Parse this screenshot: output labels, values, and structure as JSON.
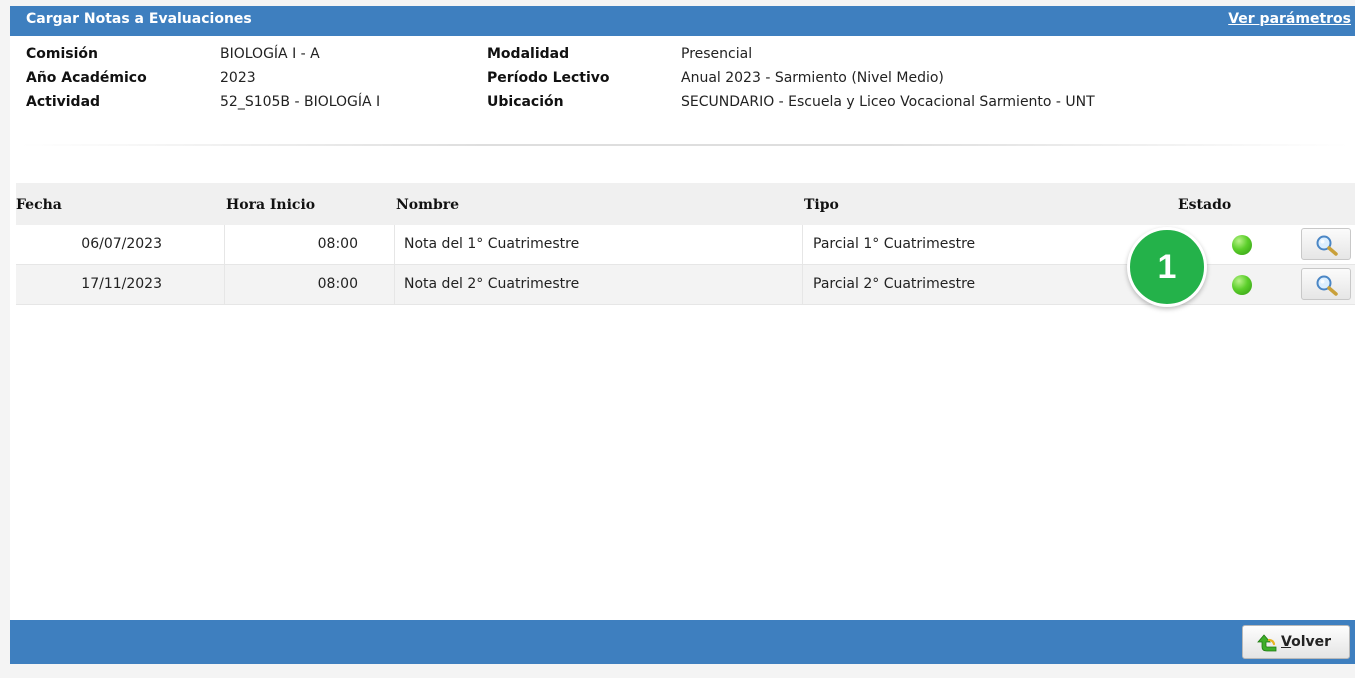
{
  "header": {
    "title": "Cargar Notas a Evaluaciones",
    "params_link": "Ver parámetros"
  },
  "info": {
    "comision_label": "Comisión",
    "comision_value": "BIOLOGÍA I - A",
    "anio_label": "Año Académico",
    "anio_value": "2023",
    "actividad_label": "Actividad",
    "actividad_value": "52_S105B - BIOLOGÍA I",
    "modalidad_label": "Modalidad",
    "modalidad_value": "Presencial",
    "periodo_label": "Período Lectivo",
    "periodo_value": "Anual 2023 - Sarmiento (Nivel Medio)",
    "ubicacion_label": "Ubicación",
    "ubicacion_value": "SECUNDARIO - Escuela y Liceo Vocacional Sarmiento - UNT"
  },
  "table": {
    "columns": [
      "Fecha",
      "Hora Inicio",
      "Nombre",
      "Tipo",
      "Estado"
    ],
    "rows": [
      {
        "fecha": "06/07/2023",
        "hora": "08:00",
        "nombre": "Nota del 1° Cuatrimestre",
        "tipo": "Parcial 1° Cuatrimestre",
        "estado": "green-dot"
      },
      {
        "fecha": "17/11/2023",
        "hora": "08:00",
        "nombre": "Nota del 2° Cuatrimestre",
        "tipo": "Parcial 2° Cuatrimestre",
        "estado": "green-dot"
      }
    ]
  },
  "annotation": {
    "badge": "1",
    "color": "#24b24a"
  },
  "footer": {
    "back_first_letter": "V",
    "back_rest": "olver"
  },
  "colors": {
    "bar": "#3e7fbf",
    "status_ok": "#5ccf2b"
  },
  "icons": {
    "view": "magnifier-icon",
    "back": "green-back-arrow-icon"
  }
}
